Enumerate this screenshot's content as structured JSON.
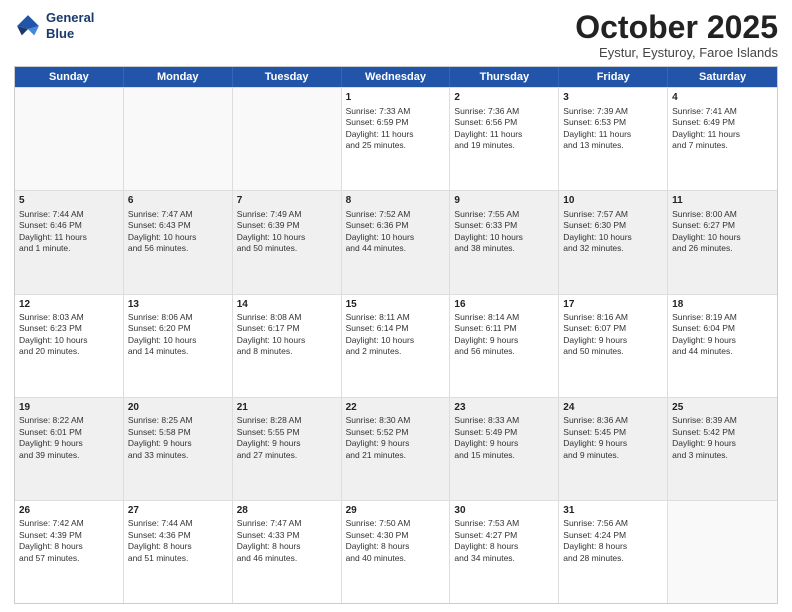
{
  "logo": {
    "line1": "General",
    "line2": "Blue"
  },
  "header": {
    "month": "October 2025",
    "location": "Eystur, Eysturoy, Faroe Islands"
  },
  "days": [
    "Sunday",
    "Monday",
    "Tuesday",
    "Wednesday",
    "Thursday",
    "Friday",
    "Saturday"
  ],
  "rows": [
    [
      {
        "num": "",
        "content": ""
      },
      {
        "num": "",
        "content": ""
      },
      {
        "num": "",
        "content": ""
      },
      {
        "num": "1",
        "content": "Sunrise: 7:33 AM\nSunset: 6:59 PM\nDaylight: 11 hours\nand 25 minutes."
      },
      {
        "num": "2",
        "content": "Sunrise: 7:36 AM\nSunset: 6:56 PM\nDaylight: 11 hours\nand 19 minutes."
      },
      {
        "num": "3",
        "content": "Sunrise: 7:39 AM\nSunset: 6:53 PM\nDaylight: 11 hours\nand 13 minutes."
      },
      {
        "num": "4",
        "content": "Sunrise: 7:41 AM\nSunset: 6:49 PM\nDaylight: 11 hours\nand 7 minutes."
      }
    ],
    [
      {
        "num": "5",
        "content": "Sunrise: 7:44 AM\nSunset: 6:46 PM\nDaylight: 11 hours\nand 1 minute."
      },
      {
        "num": "6",
        "content": "Sunrise: 7:47 AM\nSunset: 6:43 PM\nDaylight: 10 hours\nand 56 minutes."
      },
      {
        "num": "7",
        "content": "Sunrise: 7:49 AM\nSunset: 6:39 PM\nDaylight: 10 hours\nand 50 minutes."
      },
      {
        "num": "8",
        "content": "Sunrise: 7:52 AM\nSunset: 6:36 PM\nDaylight: 10 hours\nand 44 minutes."
      },
      {
        "num": "9",
        "content": "Sunrise: 7:55 AM\nSunset: 6:33 PM\nDaylight: 10 hours\nand 38 minutes."
      },
      {
        "num": "10",
        "content": "Sunrise: 7:57 AM\nSunset: 6:30 PM\nDaylight: 10 hours\nand 32 minutes."
      },
      {
        "num": "11",
        "content": "Sunrise: 8:00 AM\nSunset: 6:27 PM\nDaylight: 10 hours\nand 26 minutes."
      }
    ],
    [
      {
        "num": "12",
        "content": "Sunrise: 8:03 AM\nSunset: 6:23 PM\nDaylight: 10 hours\nand 20 minutes."
      },
      {
        "num": "13",
        "content": "Sunrise: 8:06 AM\nSunset: 6:20 PM\nDaylight: 10 hours\nand 14 minutes."
      },
      {
        "num": "14",
        "content": "Sunrise: 8:08 AM\nSunset: 6:17 PM\nDaylight: 10 hours\nand 8 minutes."
      },
      {
        "num": "15",
        "content": "Sunrise: 8:11 AM\nSunset: 6:14 PM\nDaylight: 10 hours\nand 2 minutes."
      },
      {
        "num": "16",
        "content": "Sunrise: 8:14 AM\nSunset: 6:11 PM\nDaylight: 9 hours\nand 56 minutes."
      },
      {
        "num": "17",
        "content": "Sunrise: 8:16 AM\nSunset: 6:07 PM\nDaylight: 9 hours\nand 50 minutes."
      },
      {
        "num": "18",
        "content": "Sunrise: 8:19 AM\nSunset: 6:04 PM\nDaylight: 9 hours\nand 44 minutes."
      }
    ],
    [
      {
        "num": "19",
        "content": "Sunrise: 8:22 AM\nSunset: 6:01 PM\nDaylight: 9 hours\nand 39 minutes."
      },
      {
        "num": "20",
        "content": "Sunrise: 8:25 AM\nSunset: 5:58 PM\nDaylight: 9 hours\nand 33 minutes."
      },
      {
        "num": "21",
        "content": "Sunrise: 8:28 AM\nSunset: 5:55 PM\nDaylight: 9 hours\nand 27 minutes."
      },
      {
        "num": "22",
        "content": "Sunrise: 8:30 AM\nSunset: 5:52 PM\nDaylight: 9 hours\nand 21 minutes."
      },
      {
        "num": "23",
        "content": "Sunrise: 8:33 AM\nSunset: 5:49 PM\nDaylight: 9 hours\nand 15 minutes."
      },
      {
        "num": "24",
        "content": "Sunrise: 8:36 AM\nSunset: 5:45 PM\nDaylight: 9 hours\nand 9 minutes."
      },
      {
        "num": "25",
        "content": "Sunrise: 8:39 AM\nSunset: 5:42 PM\nDaylight: 9 hours\nand 3 minutes."
      }
    ],
    [
      {
        "num": "26",
        "content": "Sunrise: 7:42 AM\nSunset: 4:39 PM\nDaylight: 8 hours\nand 57 minutes."
      },
      {
        "num": "27",
        "content": "Sunrise: 7:44 AM\nSunset: 4:36 PM\nDaylight: 8 hours\nand 51 minutes."
      },
      {
        "num": "28",
        "content": "Sunrise: 7:47 AM\nSunset: 4:33 PM\nDaylight: 8 hours\nand 46 minutes."
      },
      {
        "num": "29",
        "content": "Sunrise: 7:50 AM\nSunset: 4:30 PM\nDaylight: 8 hours\nand 40 minutes."
      },
      {
        "num": "30",
        "content": "Sunrise: 7:53 AM\nSunset: 4:27 PM\nDaylight: 8 hours\nand 34 minutes."
      },
      {
        "num": "31",
        "content": "Sunrise: 7:56 AM\nSunset: 4:24 PM\nDaylight: 8 hours\nand 28 minutes."
      },
      {
        "num": "",
        "content": ""
      }
    ]
  ]
}
